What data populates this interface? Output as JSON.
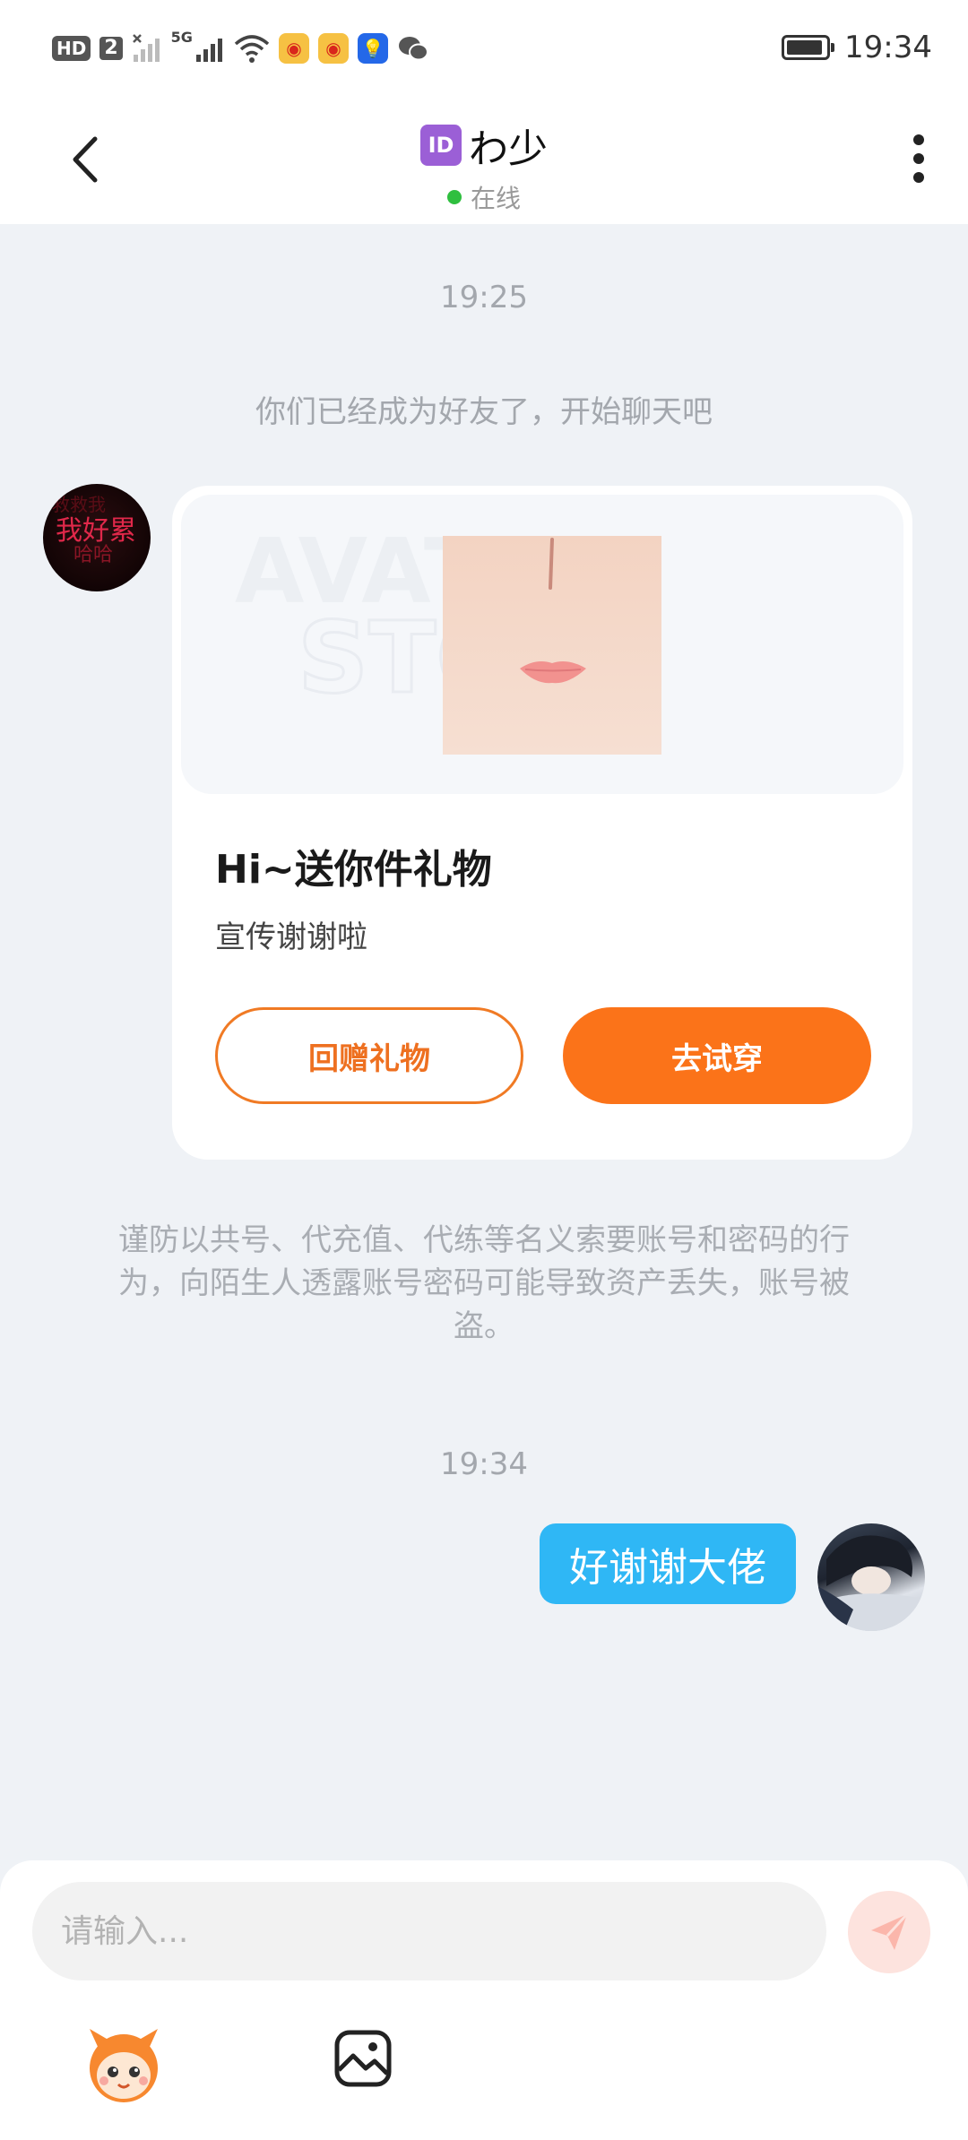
{
  "status_bar": {
    "hd": "HD",
    "sim": "2",
    "network": "5G",
    "time": "19:34"
  },
  "header": {
    "id_badge": "ID",
    "contact_name": "わ少",
    "status": "在线",
    "status_color": "#2fbf3f"
  },
  "chat": {
    "timestamp_1": "19:25",
    "system_message": "你们已经成为好友了，开始聊天吧",
    "gift_card": {
      "title": "Hi~送你件礼物",
      "subtitle": "宣传谢谢啦",
      "return_button": "回赠礼物",
      "try_button": "去试穿",
      "accent_color": "#fb7319"
    },
    "warning": "谨防以共号、代充值、代练等名义索要账号和密码的行为，向陌生人透露账号密码可能导致资产丢失，账号被盗。",
    "timestamp_2": "19:34",
    "outgoing_message": "好谢谢大佬",
    "bubble_color": "#2fb7f5"
  },
  "input": {
    "placeholder": "请输入..."
  },
  "icons": {
    "back": "back-arrow-icon",
    "more": "more-vertical-icon",
    "send": "send-paper-plane-icon",
    "emoji": "mascot-emoji-icon",
    "image": "image-icon"
  }
}
